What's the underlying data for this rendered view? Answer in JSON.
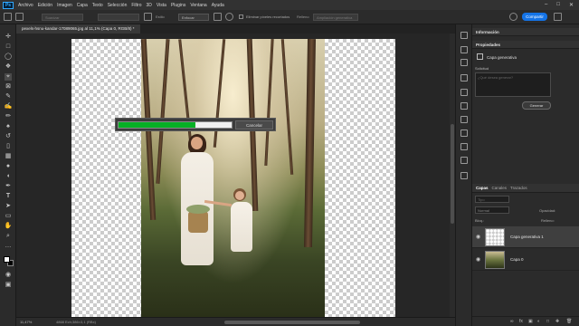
{
  "app": {
    "logo": "Ps"
  },
  "menu": [
    "Archivo",
    "Edición",
    "Imagen",
    "Capa",
    "Texto",
    "Selección",
    "Filtro",
    "3D",
    "Vista",
    "Plugins",
    "Ventana",
    "Ayuda"
  ],
  "options_bar": {
    "feather_field": "Suavizar",
    "blur_label": "Estilo",
    "select_subject": "Enfocar",
    "delete_cropped_label": "Eliminar píxeles recortados",
    "content_field": "Relleno",
    "content_value": "Ampliación generativa",
    "share_button": "Compartir"
  },
  "document": {
    "tab_title": "pexels-hsnu-kandar-17089065.jpg al 11,1% (Capa 0, RGB/8) *"
  },
  "progress": {
    "fraction": 0.68,
    "cancel_label": "Cancelar"
  },
  "status": {
    "zoom": "11,47%",
    "info": "4868 Ech;386×3,1 (RBx)"
  },
  "panels": {
    "info_header": "Información",
    "properties_header": "Propiedades",
    "layer_type": "Capa generativa",
    "request_label": "Solicitud",
    "prompt_placeholder": "¿Qué desea generar?",
    "generate_button": "Generar"
  },
  "layers": {
    "tabs": [
      "Capas",
      "Canales",
      "Trazados"
    ],
    "search_placeholder": "Tipo",
    "blend_mode": "Normal",
    "opacity_label": "Opacidad:",
    "lock_label": "Bloq.:",
    "fill_label": "Relleno:",
    "items": [
      {
        "name": "Capa generativa 1",
        "selected": true
      },
      {
        "name": "Capa 0",
        "selected": false
      }
    ]
  },
  "colors": {
    "accent": "#1473e6",
    "progress": "#06b025",
    "bg": "#1e1e1e"
  }
}
